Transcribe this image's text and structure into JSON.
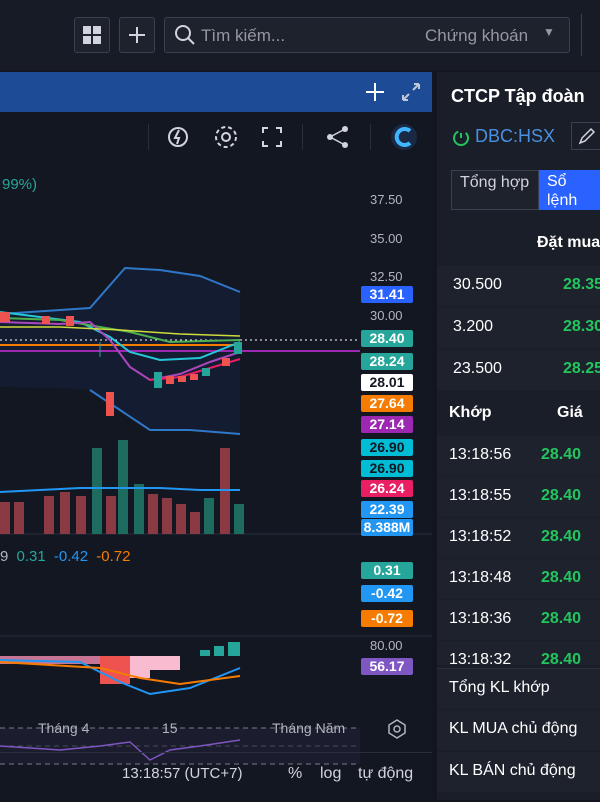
{
  "topbar": {
    "search_placeholder": "Tìm kiếm...",
    "search_category": "Chứng khoán"
  },
  "chart": {
    "legend_fragment": "99%)",
    "macd_values": [
      "9",
      "0.31",
      "-0.42",
      "-0.72"
    ],
    "axis": [
      "37.50",
      "35.00",
      "32.50",
      "30.00",
      "80.00"
    ],
    "badges": [
      {
        "value": "31.41",
        "bg": "#2962ff",
        "fg": "#ffffff"
      },
      {
        "value": "28.40",
        "bg": "#26a69a",
        "fg": "#ffffff"
      },
      {
        "value": "28.24",
        "bg": "#26a69a",
        "fg": "#ffffff"
      },
      {
        "value": "28.01",
        "bg": "#ffffff",
        "fg": "#131722"
      },
      {
        "value": "27.64",
        "bg": "#f57c00",
        "fg": "#ffffff"
      },
      {
        "value": "27.14",
        "bg": "#9c27b0",
        "fg": "#ffffff"
      },
      {
        "value": "26.90",
        "bg": "#00bcd4",
        "fg": "#131722"
      },
      {
        "value": "26.90",
        "bg": "#00bcd4",
        "fg": "#131722"
      },
      {
        "value": "26.24",
        "bg": "#e91e63",
        "fg": "#ffffff"
      },
      {
        "value": "22.39",
        "bg": "#2196f3",
        "fg": "#ffffff"
      },
      {
        "value": "8.388M",
        "bg": "#2196f3",
        "fg": "#ffffff"
      },
      {
        "value": "0.31",
        "bg": "#26a69a",
        "fg": "#ffffff"
      },
      {
        "value": "-0.42",
        "bg": "#2196f3",
        "fg": "#ffffff"
      },
      {
        "value": "-0.72",
        "bg": "#f57c00",
        "fg": "#ffffff"
      },
      {
        "value": "56.17",
        "bg": "#7e57c2",
        "fg": "#ffffff"
      }
    ],
    "time_labels": [
      "Tháng 4",
      "15",
      "Tháng Năm"
    ],
    "clock": "13:18:57 (UTC+7)",
    "percent_label": "%",
    "log_label": "log",
    "auto_label": "tự động"
  },
  "right": {
    "company": "CTCP Tập đoàn",
    "ticker": "DBC:HSX",
    "tabs": [
      "Tổng hợp",
      "Sổ lệnh"
    ],
    "buy_header": "Đặt mua",
    "orderbook": [
      {
        "qty": "30.500",
        "price": "28.35"
      },
      {
        "qty": "3.200",
        "price": "28.30"
      },
      {
        "qty": "23.500",
        "price": "28.25"
      }
    ],
    "trades_headers": [
      "Khớp",
      "Giá"
    ],
    "trades": [
      {
        "time": "13:18:56",
        "price": "28.40"
      },
      {
        "time": "13:18:55",
        "price": "28.40"
      },
      {
        "time": "13:18:52",
        "price": "28.40"
      },
      {
        "time": "13:18:48",
        "price": "28.40"
      },
      {
        "time": "13:18:36",
        "price": "28.40"
      },
      {
        "time": "13:18:32",
        "price": "28.40"
      }
    ],
    "summary": [
      "Tổng KL khớp",
      "KL MUA chủ động",
      "KL BÁN chủ động"
    ]
  }
}
